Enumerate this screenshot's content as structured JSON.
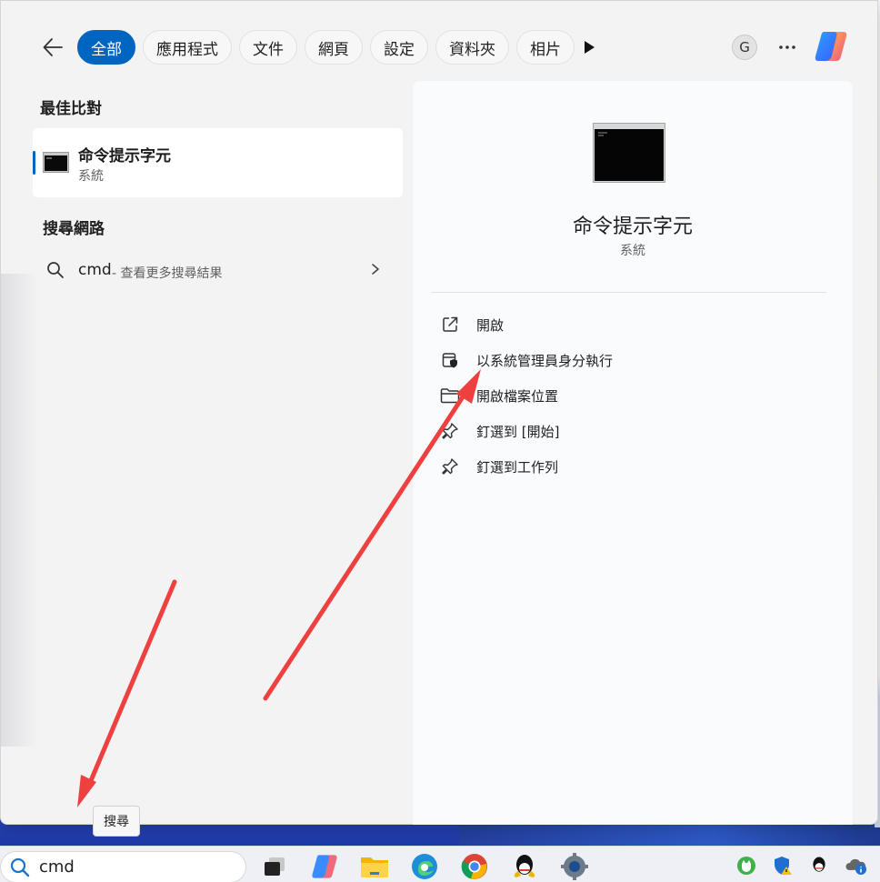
{
  "filters": {
    "back_label": "",
    "tabs": [
      {
        "label": "全部",
        "active": true
      },
      {
        "label": "應用程式",
        "active": false
      },
      {
        "label": "文件",
        "active": false
      },
      {
        "label": "網頁",
        "active": false
      },
      {
        "label": "設定",
        "active": false
      },
      {
        "label": "資料夾",
        "active": false
      },
      {
        "label": "相片",
        "active": false
      }
    ],
    "more_icon": "play-icon",
    "account_initial": "G",
    "options_icon": "more-icon",
    "copilot_icon": "copilot-icon"
  },
  "best_match": {
    "heading": "最佳比對",
    "name": "命令提示字元",
    "type": "系統",
    "icon": "terminal-icon"
  },
  "web_search": {
    "heading": "搜尋網路",
    "query": "cmd",
    "hint": "- 查看更多搜尋結果",
    "icon": "search-icon"
  },
  "detail": {
    "title": "命令提示字元",
    "subtitle": "系統",
    "actions": [
      {
        "label": "開啟",
        "icon": "open-external-icon"
      },
      {
        "label": "以系統管理員身分執行",
        "icon": "shield-icon"
      },
      {
        "label": "開啟檔案位置",
        "icon": "folder-icon"
      },
      {
        "label": "釘選到 [開始]",
        "icon": "pin-icon"
      },
      {
        "label": "釘選到工作列",
        "icon": "pin-icon"
      }
    ]
  },
  "tooltip": "搜尋",
  "taskbar": {
    "search_value": "cmd",
    "apps": [
      "task-view-icon",
      "copilot-icon",
      "file-explorer-icon",
      "edge-icon",
      "chrome-icon",
      "qq-icon",
      "settings-icon"
    ],
    "tray": [
      "cat-app-icon",
      "defender-warning-icon",
      "qq-tray-icon",
      "onedrive-info-icon"
    ]
  },
  "colors": {
    "accent": "#0064c1",
    "annotation_arrow": "#ef4040"
  }
}
